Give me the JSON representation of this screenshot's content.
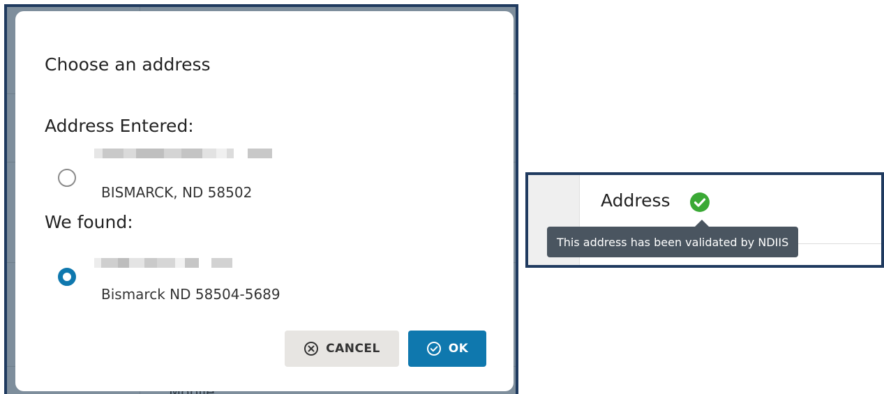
{
  "dialog": {
    "title": "Choose an address",
    "entered": {
      "heading": "Address Entered:",
      "city_line": "BISMARCK, ND 58502",
      "selected": false
    },
    "found": {
      "heading": "We found:",
      "city_line": "Bismarck ND 58504-5689",
      "selected": true
    },
    "cancel_label": "CANCEL",
    "ok_label": "OK",
    "cancel_icon": "circle-x-icon",
    "ok_icon": "circle-check-icon"
  },
  "address_field": {
    "label": "Address",
    "status_icon": "green-check-circle-icon",
    "tooltip": "This address has been validated by NDIIS"
  },
  "colors": {
    "primary": "#0f78ae",
    "frame": "#1f3a5f",
    "success": "#3aa935",
    "tooltip_bg": "#4a5560",
    "overlay": "#7e8e9c"
  }
}
